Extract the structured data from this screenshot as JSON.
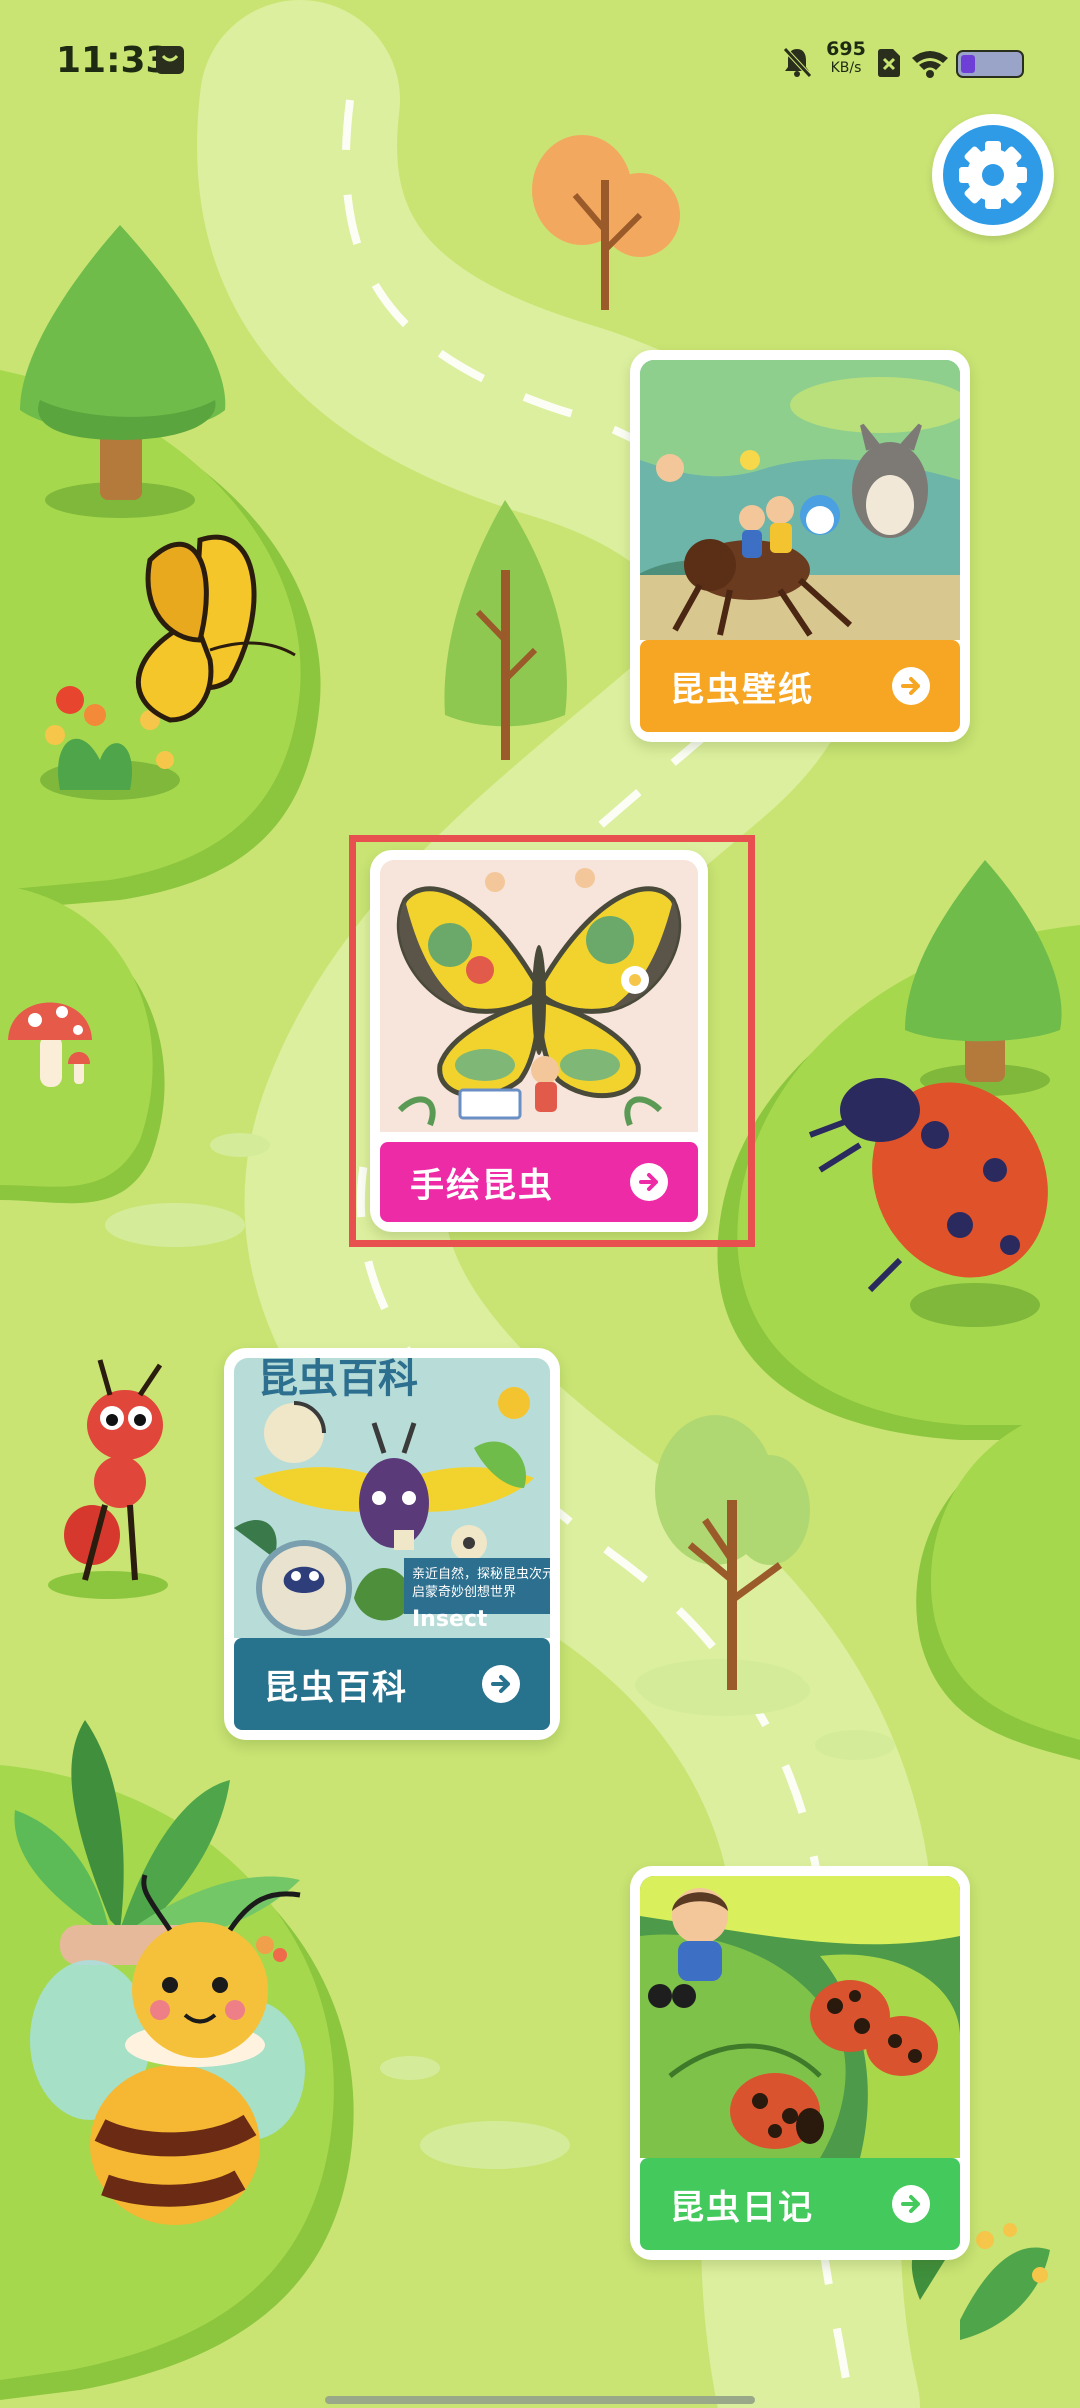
{
  "status_bar": {
    "time": "11:33",
    "net_speed_value": "695",
    "net_speed_unit": "KB/s",
    "icons": [
      "message-icon",
      "mute-bell-icon",
      "no-sim-icon",
      "wifi-icon",
      "battery-icon"
    ]
  },
  "settings": {
    "icon": "gear-icon",
    "color": "#2f9be6"
  },
  "cards": [
    {
      "id": "wallpaper",
      "label": "昆虫壁纸",
      "color": "#f6a623"
    },
    {
      "id": "hand_drawn",
      "label": "手绘昆虫",
      "color": "#ee2ba6"
    },
    {
      "id": "encyclopedia",
      "label": "昆虫百科",
      "color": "#27728d",
      "cover_title": "昆虫百科",
      "cover_text_1": "亲近自然，探秘昆虫次元",
      "cover_text_2": "启蒙奇妙创想世界",
      "cover_brand": "Insect"
    },
    {
      "id": "diary",
      "label": "昆虫日记",
      "color": "#44c95c"
    }
  ],
  "highlight_color": "#e85050"
}
